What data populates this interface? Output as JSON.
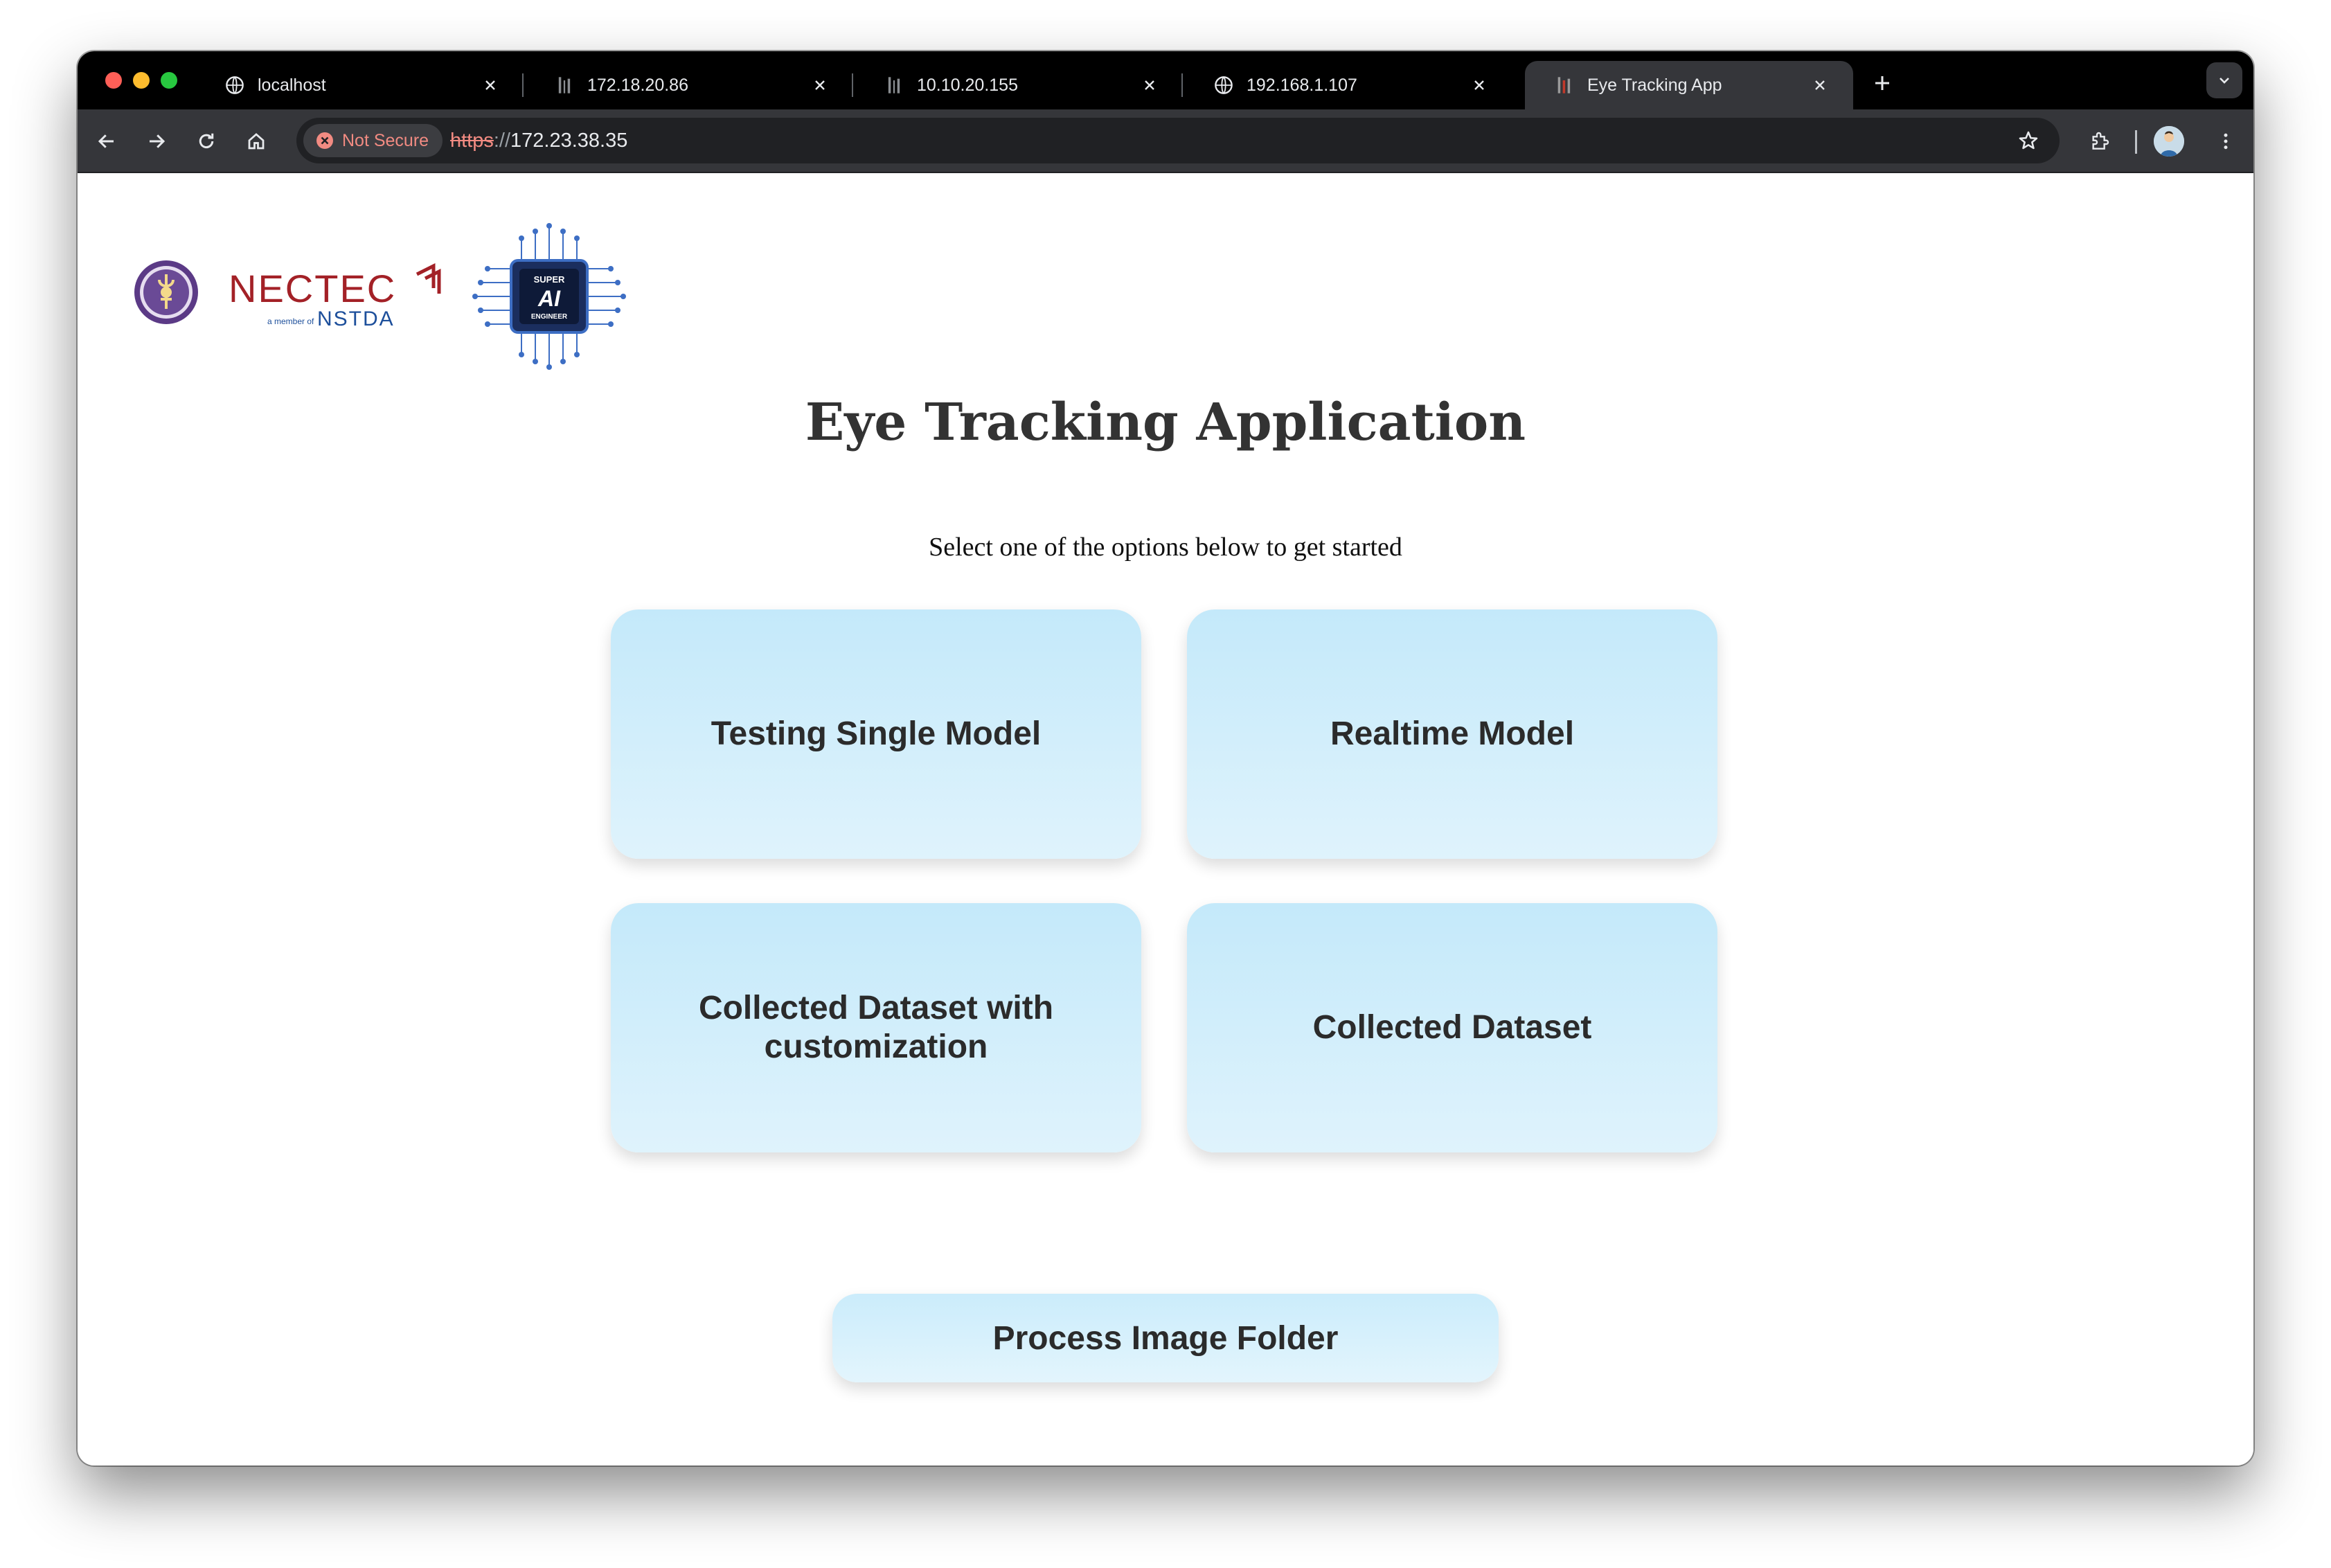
{
  "browser": {
    "tabs": [
      {
        "title": "localhost",
        "favicon": "globe-icon",
        "active": false
      },
      {
        "title": "172.18.20.86",
        "favicon": "page-icon",
        "active": false
      },
      {
        "title": "10.10.20.155",
        "favicon": "page-icon",
        "active": false
      },
      {
        "title": "192.168.1.107",
        "favicon": "globe-icon",
        "active": false
      },
      {
        "title": "Eye Tracking App",
        "favicon": "app-icon",
        "active": true
      }
    ],
    "security_label": "Not Secure",
    "url_scheme": "https",
    "url_separator": "://",
    "url_host": "172.23.38.35",
    "colors": {
      "frame": "#000000",
      "toolbar": "#35363a",
      "omnibox": "#202124",
      "warning": "#f28b82"
    }
  },
  "logos": {
    "nectec_text": "NECTEC",
    "nectec_tagline": "a member of",
    "nstda_text": "NSTDA",
    "superai_text_top": "SUPER",
    "superai_text_mid": "AI",
    "superai_text_bottom": "ENGINEER"
  },
  "page": {
    "title": "Eye Tracking Application",
    "subtitle": "Select one of the options below to get started",
    "cards": [
      {
        "label": "Testing Single Model"
      },
      {
        "label": "Realtime Model"
      },
      {
        "label": "Collected Dataset with customization"
      },
      {
        "label": "Collected Dataset"
      }
    ],
    "process_button": "Process Image Folder",
    "fab_icon": "menu-icon",
    "colors": {
      "card_top": "#c4e9fa",
      "card_bottom": "#dff3fc",
      "fab": "#2f6fe8",
      "text": "#2b2b2b"
    }
  }
}
